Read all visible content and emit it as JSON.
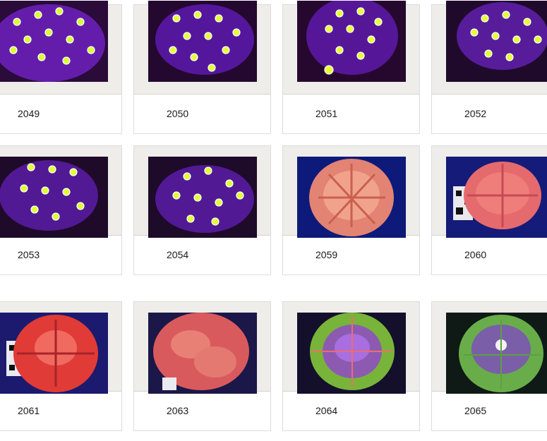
{
  "gallery": {
    "items": [
      {
        "id": "2049",
        "kind": "zoanthid"
      },
      {
        "id": "2050",
        "kind": "zoanthid"
      },
      {
        "id": "2051",
        "kind": "zoanthid"
      },
      {
        "id": "2052",
        "kind": "zoanthid"
      },
      {
        "id": "2053",
        "kind": "zoanthid"
      },
      {
        "id": "2054",
        "kind": "zoanthid"
      },
      {
        "id": "2059",
        "kind": "scoly-orange"
      },
      {
        "id": "2060",
        "kind": "scoly-pink-qr"
      },
      {
        "id": "2061",
        "kind": "scoly-red-qr"
      },
      {
        "id": "2063",
        "kind": "scoly-pink-lumpy"
      },
      {
        "id": "2064",
        "kind": "scoly-green-purple"
      },
      {
        "id": "2065",
        "kind": "scoly-green"
      }
    ]
  }
}
